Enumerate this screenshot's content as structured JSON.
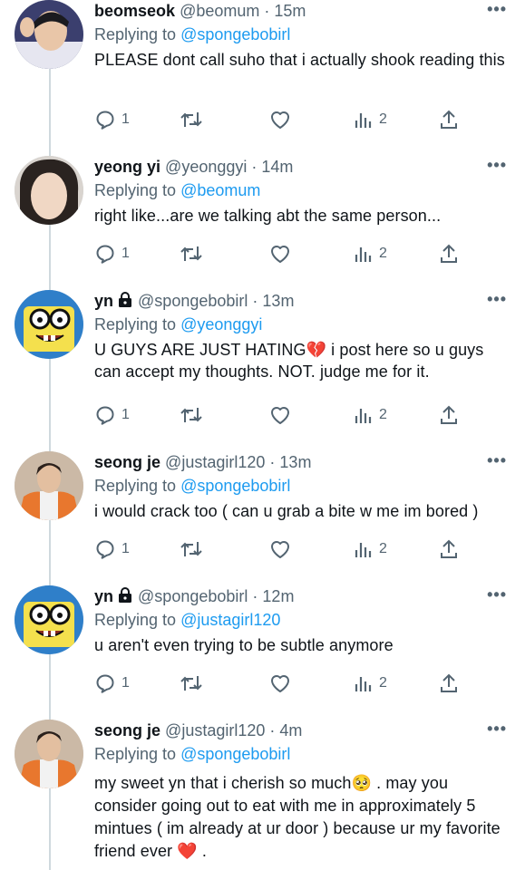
{
  "tweets": [
    {
      "name": "beomseok",
      "handle": "@beomum",
      "time": "15m",
      "replying_prefix": "Replying to ",
      "replying_to": "@spongebobirl",
      "text": "PLEASE dont call suho that i actually shook reading this",
      "replies": "1",
      "views": "2",
      "locked": false
    },
    {
      "name": "yeong yi",
      "handle": "@yeonggyi",
      "time": "14m",
      "replying_prefix": "Replying to ",
      "replying_to": "@beomum",
      "text": "right like...are we talking abt the same person...",
      "replies": "1",
      "views": "2",
      "locked": false
    },
    {
      "name": "yn",
      "handle": "@spongebobirl",
      "time": "13m",
      "replying_prefix": "Replying to ",
      "replying_to": "@yeonggyi",
      "text": "U GUYS ARE JUST HATING💔  i post here so u guys can accept my thoughts. NOT. judge me for it.",
      "replies": "1",
      "views": "2",
      "locked": true
    },
    {
      "name": "seong je",
      "handle": "@justagirl120",
      "time": "13m",
      "replying_prefix": "Replying to ",
      "replying_to": "@spongebobirl",
      "text": "i would crack too ( can u grab a bite w me im bored )",
      "replies": "1",
      "views": "2",
      "locked": false
    },
    {
      "name": "yn",
      "handle": "@spongebobirl",
      "time": "12m",
      "replying_prefix": "Replying to ",
      "replying_to": "@justagirl120",
      "text": "u aren't even trying to be subtle anymore",
      "replies": "1",
      "views": "2",
      "locked": true
    },
    {
      "name": "seong je",
      "handle": "@justagirl120",
      "time": "4m",
      "replying_prefix": "Replying to ",
      "replying_to": "@spongebobirl",
      "text": "my sweet yn that i cherish so much🥺 . may you consider going out to eat with me in approximately 5 mintues ( im already at ur door ) because ur my favorite friend ever ❤️ .",
      "replies": "",
      "views": "",
      "locked": false
    }
  ],
  "separator": "·",
  "more_label": "•••",
  "icons": {
    "reply": "reply-icon",
    "retweet": "retweet-icon",
    "like": "heart-icon",
    "views": "views-icon",
    "share": "share-icon",
    "lock": "lock-icon"
  },
  "colors": {
    "link": "#1d9bf0",
    "muted": "#536471",
    "text": "#0f1419"
  }
}
